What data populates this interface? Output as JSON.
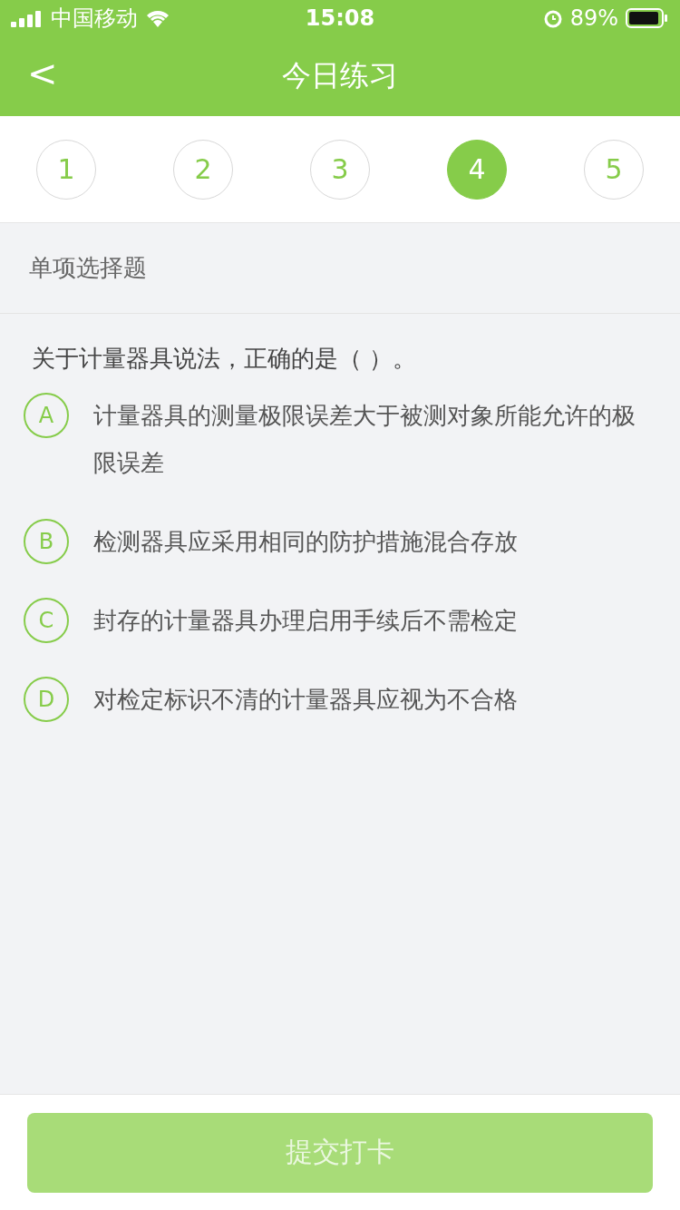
{
  "status_bar": {
    "carrier": "中国移动",
    "time": "15:08",
    "battery": "89%"
  },
  "header": {
    "back": "<",
    "title": "今日练习"
  },
  "steps": [
    {
      "label": "1",
      "selected": false
    },
    {
      "label": "2",
      "selected": false
    },
    {
      "label": "3",
      "selected": false
    },
    {
      "label": "4",
      "selected": true
    },
    {
      "label": "5",
      "selected": false
    }
  ],
  "question_type": "单项选择题",
  "question": "关于计量器具说法，正确的是（    ）。",
  "options": [
    {
      "letter": "A",
      "text": "计量器具的测量极限误差大于被测对象所能允许的极限误差",
      "selected": false
    },
    {
      "letter": "B",
      "text": "检测器具应采用相同的防护措施混合存放",
      "selected": false
    },
    {
      "letter": "C",
      "text": "封存的计量器具办理启用手续后不需检定",
      "selected": false
    },
    {
      "letter": "D",
      "text": "对检定标识不清的计量器具应视为不合格",
      "selected": false
    }
  ],
  "submit": {
    "label": "提交打卡",
    "disabled": true
  }
}
